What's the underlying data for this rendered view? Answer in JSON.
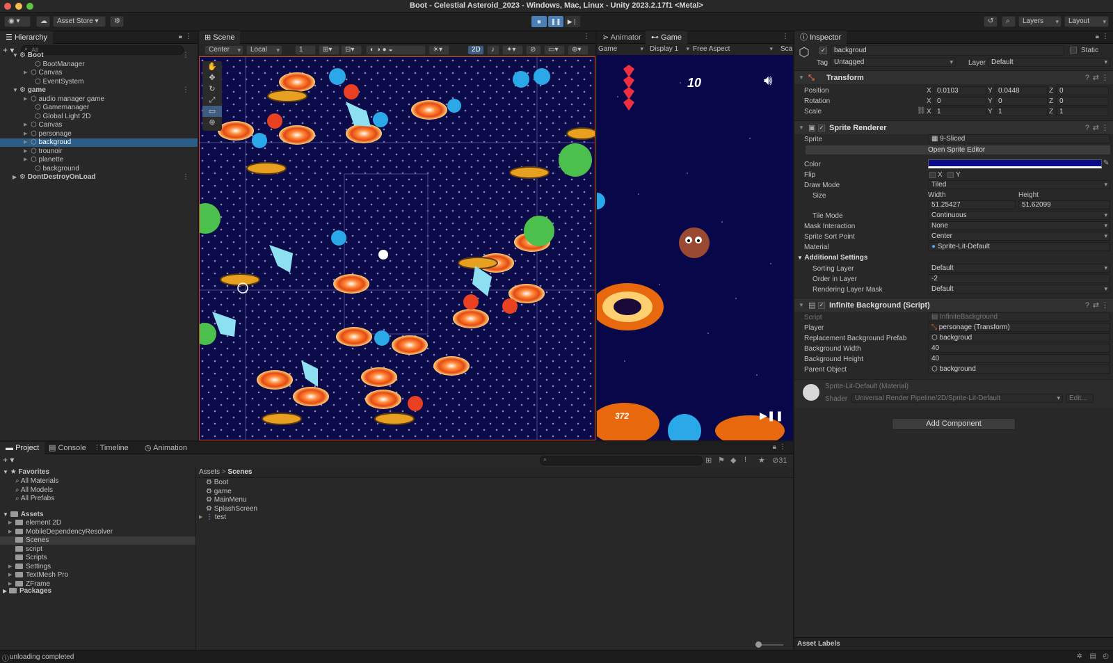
{
  "window": {
    "title": "Boot - Celestial Asteroid_2023 - Windows, Mac, Linux - Unity 2023.2.17f1 <Metal>"
  },
  "toolbar": {
    "asset_store": "Asset Store",
    "layers": "Layers",
    "layout": "Layout"
  },
  "hierarchy": {
    "tab": "Hierarchy",
    "search_placeholder": "All",
    "rows": [
      {
        "label": "Boot",
        "depth": 0,
        "scene": true,
        "open": true
      },
      {
        "label": "BootManager",
        "depth": 2
      },
      {
        "label": "Canvas",
        "depth": 1,
        "arrow": true
      },
      {
        "label": "EventSystem",
        "depth": 2
      },
      {
        "label": "game",
        "depth": 0,
        "scene": true,
        "open": true
      },
      {
        "label": "audio manager game",
        "depth": 1,
        "arrow": true
      },
      {
        "label": "Gamemanager",
        "depth": 2
      },
      {
        "label": "Global Light 2D",
        "depth": 2
      },
      {
        "label": "Canvas",
        "depth": 1,
        "arrow": true
      },
      {
        "label": "personage",
        "depth": 1,
        "arrow": true
      },
      {
        "label": "backgroud",
        "depth": 1,
        "arrow": true,
        "selected": true
      },
      {
        "label": "trounoir",
        "depth": 1,
        "arrow": true
      },
      {
        "label": "planette",
        "depth": 1,
        "arrow": true
      },
      {
        "label": "background",
        "depth": 2
      },
      {
        "label": "DontDestroyOnLoad",
        "depth": 0,
        "scene": true,
        "open": false
      }
    ]
  },
  "scene": {
    "tab": "Scene",
    "pivot": "Center",
    "space": "Local",
    "snap_value": "1",
    "mode_2d": "2D"
  },
  "game": {
    "tabs": [
      "Animator",
      "Game"
    ],
    "display_mode": "Game",
    "display": "Display 1",
    "aspect": "Free Aspect",
    "scale_label": "Sca",
    "score": "10",
    "distance": "372"
  },
  "inspector": {
    "tab": "Inspector",
    "object_name": "backgroud",
    "static_label": "Static",
    "tag_label": "Tag",
    "tag_value": "Untagged",
    "layer_label": "Layer",
    "layer_value": "Default",
    "transform": {
      "title": "Transform",
      "position": {
        "label": "Position",
        "x": "0.0103",
        "y": "0.0448",
        "z": "0"
      },
      "rotation": {
        "label": "Rotation",
        "x": "0",
        "y": "0",
        "z": "0"
      },
      "scale": {
        "label": "Scale",
        "x": "1",
        "y": "1",
        "z": "1"
      }
    },
    "sprite_renderer": {
      "title": "Sprite Renderer",
      "sprite_label": "Sprite",
      "sprite_value": "9-Sliced",
      "open_editor": "Open Sprite Editor",
      "color_label": "Color",
      "color_value": "#0a0a8a",
      "flip_label": "Flip",
      "flip_x": "X",
      "flip_y": "Y",
      "draw_mode_label": "Draw Mode",
      "draw_mode_value": "Tiled",
      "size_label": "Size",
      "width_label": "Width",
      "height_label": "Height",
      "width_value": "51.25427",
      "height_value": "51.62099",
      "tile_mode_label": "Tile Mode",
      "tile_mode_value": "Continuous",
      "mask_label": "Mask Interaction",
      "mask_value": "None",
      "sort_point_label": "Sprite Sort Point",
      "sort_point_value": "Center",
      "material_label": "Material",
      "material_value": "Sprite-Lit-Default",
      "additional": "Additional Settings",
      "sorting_layer_label": "Sorting Layer",
      "sorting_layer_value": "Default",
      "order_label": "Order in Layer",
      "order_value": "-2",
      "rlm_label": "Rendering Layer Mask",
      "rlm_value": "Default"
    },
    "infinite_bg": {
      "title": "Infinite Background (Script)",
      "script_label": "Script",
      "script_value": "InfiniteBackground",
      "player_label": "Player",
      "player_value": "personage (Transform)",
      "prefab_label": "Replacement Background Prefab",
      "prefab_value": "backgroud",
      "bgw_label": "Background Width",
      "bgw_value": "40",
      "bgh_label": "Background Height",
      "bgh_value": "40",
      "parent_label": "Parent Object",
      "parent_value": "background"
    },
    "material": {
      "title": "Sprite-Lit-Default (Material)",
      "shader_label": "Shader",
      "shader_value": "Universal Render Pipeline/2D/Sprite-Lit-Default",
      "edit": "Edit..."
    },
    "add_component": "Add Component",
    "asset_labels": "Asset Labels"
  },
  "bottom": {
    "tabs": [
      "Project",
      "Console",
      "Timeline",
      "Animation"
    ],
    "count": "31",
    "favorites": {
      "label": "Favorites",
      "items": [
        "All Materials",
        "All Models",
        "All Prefabs"
      ]
    },
    "assets": {
      "label": "Assets",
      "items": [
        "element 2D",
        "MobileDependencyResolver",
        "Scenes",
        "script",
        "Scripts",
        "Settings",
        "TextMesh Pro",
        "ZFrame"
      ]
    },
    "packages": "Packages",
    "breadcrumb": [
      "Assets",
      "Scenes"
    ],
    "files": [
      "Boot",
      "game",
      "MainMenu",
      "SplashScreen",
      "test"
    ]
  },
  "status": {
    "text": "unloading completed"
  }
}
